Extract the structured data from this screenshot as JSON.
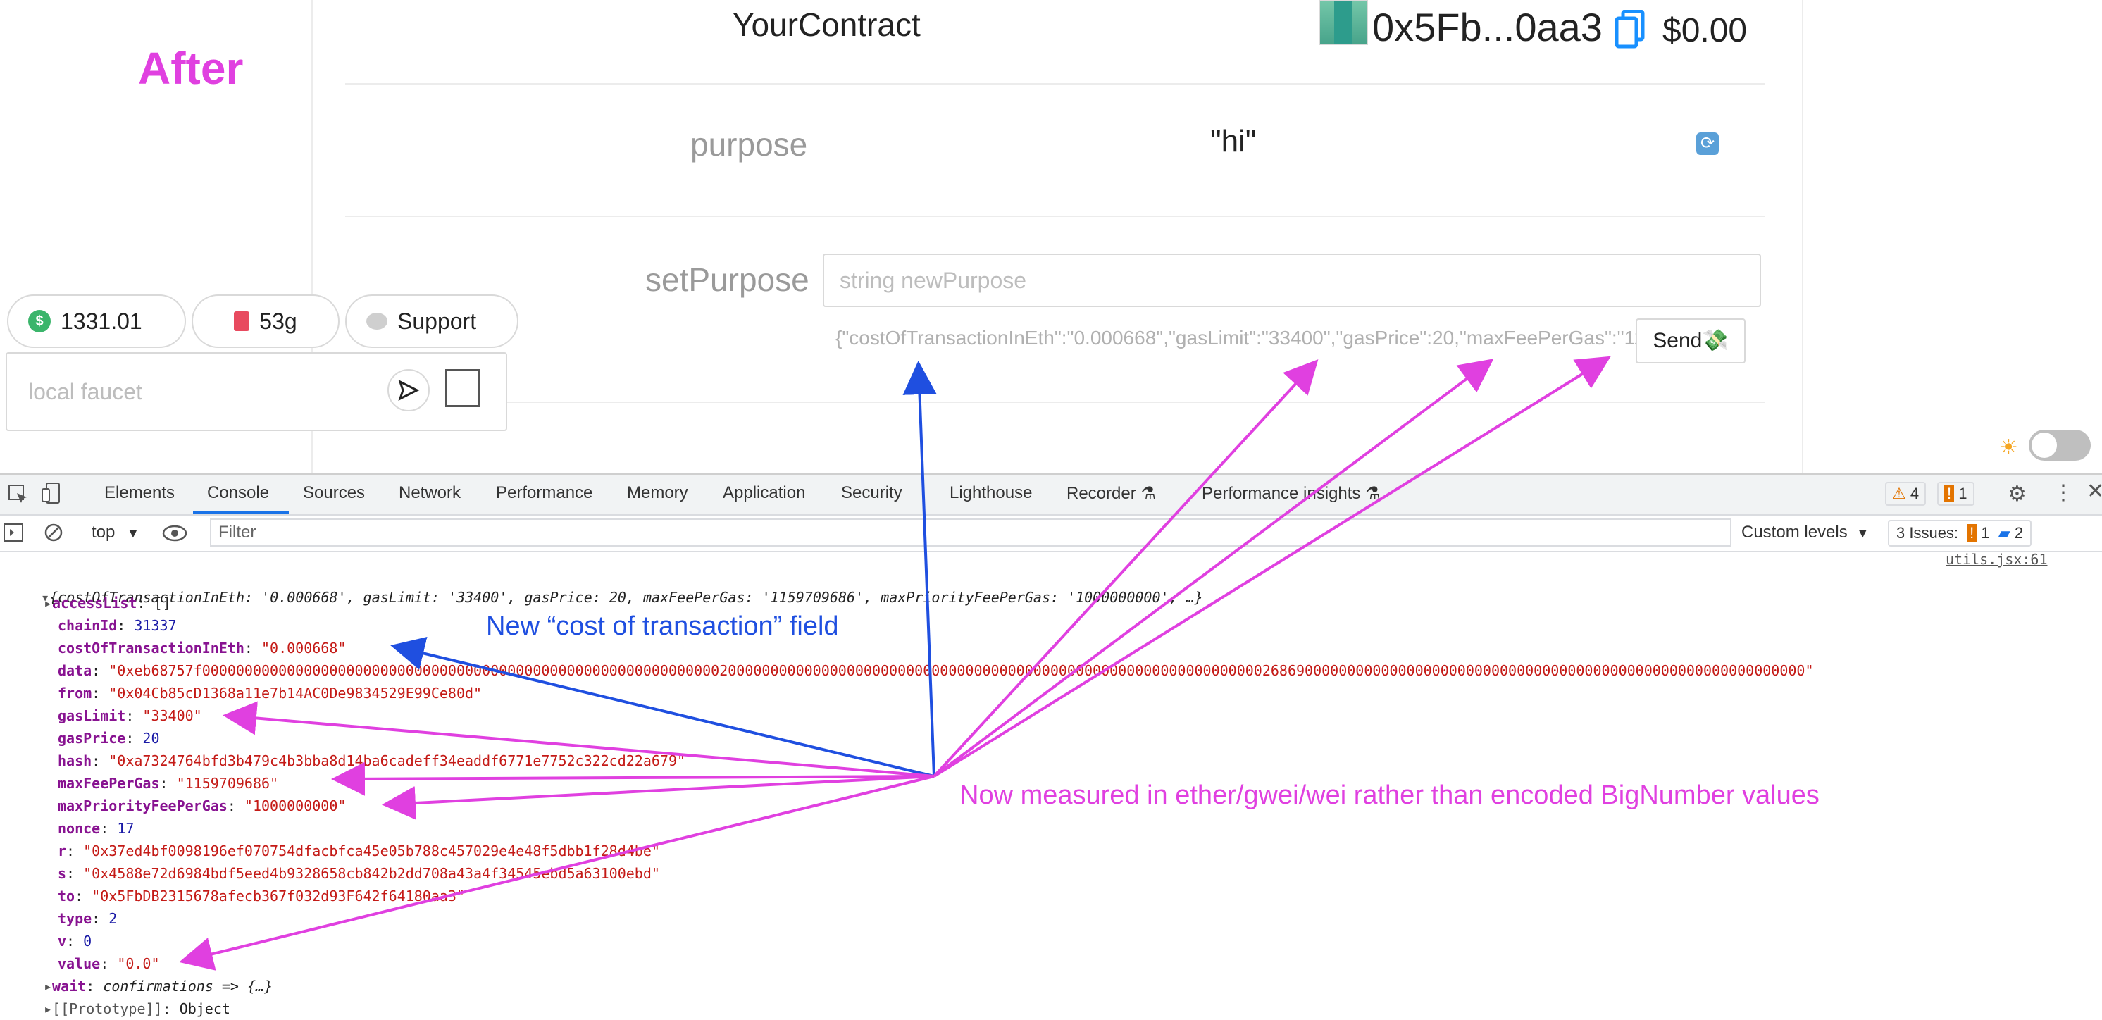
{
  "overlay": {
    "after_label": "After",
    "note_cost": "New “cost of transaction” field",
    "note_units": "Now measured in ether/gwei/wei rather than encoded BigNumber values"
  },
  "header": {
    "contract_title": "YourContract",
    "address": "0x5Fb...0aa3",
    "balance": "$0.00"
  },
  "contract": {
    "purpose_label": "purpose",
    "purpose_value": "\"hi\"",
    "setpurpose_label": "setPurpose",
    "input_placeholder": "string newPurpose",
    "tx_preview": "{\"costOfTransactionInEth\":\"0.000668\",\"gasLimit\":\"33400\",\"gasPrice\":20,\"maxFeePerGas\":\"1159709686\"",
    "send_label": "Send💸"
  },
  "pills": {
    "price": "1331.01",
    "gas": "53g",
    "support": "Support"
  },
  "faucet": {
    "placeholder": "local faucet"
  },
  "devtools": {
    "tabs": [
      "Elements",
      "Console",
      "Sources",
      "Network",
      "Performance",
      "Memory",
      "Application",
      "Security",
      "Lighthouse",
      "Recorder ⚗",
      "Performance insights ⚗"
    ],
    "warnings": "4",
    "errors": "1",
    "context": "top",
    "filter_placeholder": "Filter",
    "levels": "Custom levels",
    "issues_label": "3 Issues:",
    "issues_warn": "1",
    "issues_info": "2",
    "source_link": "utils.jsx:61"
  },
  "console": {
    "summary_prefix": "{costOfTransactionInEth: '0.000668', gasLimit: '33400', gasPrice: 20, maxFeePerGas: '1159709686', maxPriorityFeePerGas: '1000000000', …}",
    "props": [
      {
        "key": "accessList",
        "value": "[]",
        "kind": "plain",
        "caret": true
      },
      {
        "key": "chainId",
        "value": "31337",
        "kind": "num",
        "caret": false
      },
      {
        "key": "costOfTransactionInEth",
        "value": "\"0.000668\"",
        "kind": "str",
        "caret": false
      },
      {
        "key": "data",
        "value": "\"0xeb68757f000000000000000000000000000000000000000000000000000000000000020000000000000000000000000000000000000000000000000000000000000002686900000000000000000000000000000000000000000000000000000000000\"",
        "kind": "str",
        "caret": false
      },
      {
        "key": "from",
        "value": "\"0x04Cb85cD1368a11e7b14AC0De9834529E99Ce80d\"",
        "kind": "str",
        "caret": false
      },
      {
        "key": "gasLimit",
        "value": "\"33400\"",
        "kind": "str",
        "caret": false
      },
      {
        "key": "gasPrice",
        "value": "20",
        "kind": "num",
        "caret": false
      },
      {
        "key": "hash",
        "value": "\"0xa7324764bfd3b479c4b3bba8d14ba6cadeff34eaddf6771e7752c322cd22a679\"",
        "kind": "str",
        "caret": false
      },
      {
        "key": "maxFeePerGas",
        "value": "\"1159709686\"",
        "kind": "str",
        "caret": false
      },
      {
        "key": "maxPriorityFeePerGas",
        "value": "\"1000000000\"",
        "kind": "str",
        "caret": false
      },
      {
        "key": "nonce",
        "value": "17",
        "kind": "num",
        "caret": false
      },
      {
        "key": "r",
        "value": "\"0x37ed4bf0098196ef070754dfacbfca45e05b788c457029e4e48f5dbb1f28d4be\"",
        "kind": "str",
        "caret": false
      },
      {
        "key": "s",
        "value": "\"0x4588e72d6984bdf5eed4b9328658cb842b2dd708a43a4f34545ebd5a63100ebd\"",
        "kind": "str",
        "caret": false
      },
      {
        "key": "to",
        "value": "\"0x5FbDB2315678afecb367f032d93F642f64180aa3\"",
        "kind": "str",
        "caret": false
      },
      {
        "key": "type",
        "value": "2",
        "kind": "num",
        "caret": false
      },
      {
        "key": "v",
        "value": "0",
        "kind": "num",
        "caret": false
      },
      {
        "key": "value",
        "value": "\"0.0\"",
        "kind": "str",
        "caret": false
      },
      {
        "key": "wait",
        "value": "confirmations => {…}",
        "kind": "italic",
        "caret": true
      },
      {
        "key": "[[Prototype]]",
        "value": "Object",
        "kind": "proto",
        "caret": true
      }
    ]
  },
  "colors": {
    "annotation_pink": "#e040e0",
    "annotation_blue": "#1f4fe0",
    "accent": "#1a73e8"
  }
}
